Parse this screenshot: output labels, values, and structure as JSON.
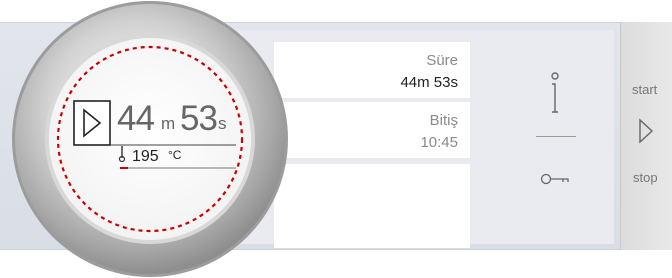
{
  "duration": {
    "label": "Süre",
    "value": "44m 53s"
  },
  "end_time": {
    "label": "Bitiş",
    "value": "10:45"
  },
  "knob": {
    "minutes": "44",
    "minutes_unit": "m",
    "seconds": "53",
    "seconds_unit": "s",
    "temperature": "195",
    "temperature_unit": "°C"
  },
  "controls": {
    "start_label": "start",
    "stop_label": "stop"
  },
  "icons": [
    "play-icon",
    "thermometer-icon",
    "info-icon",
    "key-icon",
    "start-stop-play-icon"
  ],
  "colors": {
    "accent": "#cc0000",
    "panel": "#dde0e7"
  }
}
